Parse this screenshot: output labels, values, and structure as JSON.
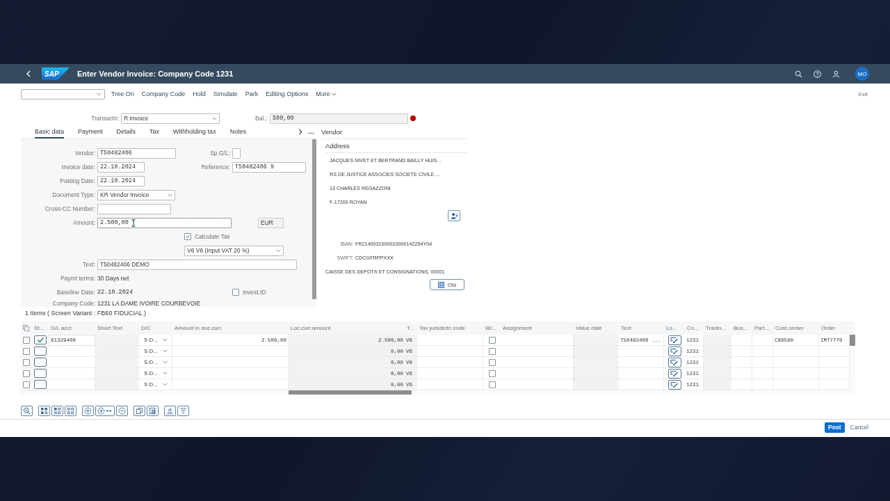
{
  "shell": {
    "logo": "SAP",
    "title": "Enter Vendor Invoice: Company Code 1231",
    "avatar": "MO"
  },
  "toolbar": {
    "buttons": [
      "Tree On",
      "Company Code",
      "Hold",
      "Simulate",
      "Park",
      "Editing Options"
    ],
    "more": "More",
    "exit": "Exit"
  },
  "header": {
    "transaction": {
      "label": "Transactn:",
      "value": "R Invoice"
    },
    "balance": {
      "label": "Bal.:",
      "value": "500,00",
      "balanced": false
    }
  },
  "tabs": [
    {
      "label": "Basic data",
      "selected": true
    },
    {
      "label": "Payment",
      "selected": false
    },
    {
      "label": "Details",
      "selected": false
    },
    {
      "label": "Tax",
      "selected": false
    },
    {
      "label": "Withholding tax",
      "selected": false
    },
    {
      "label": "Notes",
      "selected": false
    }
  ],
  "basic_data": {
    "vendor": {
      "label": "Vendor:",
      "value": "T50482406"
    },
    "special_gl": {
      "label": "Sp.G/L:"
    },
    "invoice_date": {
      "label": "Invoice date:",
      "value": "22.10.2024"
    },
    "reference": {
      "label": "Reference:",
      "value": "T50482406 9"
    },
    "posting_date": {
      "label": "Posting Date:",
      "value": "22.10.2024"
    },
    "document_type": {
      "label": "Document Type:",
      "value": "KR Vendor Invoice"
    },
    "cross_cc_number": {
      "label": "Cross-CC Number:"
    },
    "amount": {
      "label": "Amount:",
      "value": "2.500,00",
      "focused": true
    },
    "currency": "EUR",
    "calculate_tax": {
      "label": "Calculate Tax",
      "checked": true
    },
    "tax_code": "V6 V6 (Input VAT 20 %)",
    "text": {
      "label": "Text:",
      "value": "T50482406 DEMO"
    },
    "payment_terms": {
      "label": "Paymt terms:",
      "value": "30 Days net"
    },
    "baseline_date": {
      "label": "Baseline Date:",
      "value": "22.10.2024"
    },
    "invest_id": {
      "label": "Invest.ID",
      "checked": false
    },
    "company_code": {
      "label": "Company Code:",
      "value": "1231 LA DAME IVOIRE COURBEVOIE"
    }
  },
  "vendor_panel": {
    "title": "Vendor",
    "address_title": "Address",
    "address_lines": [
      "JACQUES NIVET ET BERTRAND BAILLY HUIS...",
      "RS DE JUSTICE ASSOCIES SOCIETE CIVILE ...",
      "13 CHARLES REGAZZONI",
      "F-17200 ROYAN"
    ],
    "iban": {
      "label": "IBAN:",
      "value": "FR2140031000010000142254Y04"
    },
    "swift": {
      "label": "SWIFT:",
      "value": "CDCGFRPPXXX"
    },
    "bank": "CAISSE DES DEPOTS ET CONSIGNATIONS, 00001",
    "open_items_button": "OIs"
  },
  "items": {
    "title": "1 Items ( Screen Variant : FB60 FIDUCIAL )",
    "columns": [
      "St...",
      "G/L acct",
      "Short Text",
      "D/C",
      "Amount in doc.curr.",
      "Loc.curr.amount",
      "T...",
      "Tax jurisdictn code",
      "W/...",
      "Assignment",
      "Value date",
      "Text",
      "Lo...",
      "Co...",
      "Tradin...",
      "Bus...",
      "Part...",
      "Cost center",
      "Order"
    ],
    "rows": [
      {
        "selected": false,
        "checked": true,
        "gl_acct": "61329400",
        "dc": "S D...",
        "amount_doc": "2.500,00",
        "amount_loc": "2.500,00",
        "tax_code": "V6",
        "withholding": false,
        "text": "T50482406 ...",
        "company_code": "1231",
        "cost_center": "C89580",
        "order": "IM77770"
      },
      {
        "selected": false,
        "checked": false,
        "dc": "S D...",
        "amount_loc": "0,00",
        "tax_code": "V6",
        "withholding": false,
        "company_code": "1231"
      },
      {
        "selected": false,
        "checked": false,
        "dc": "S D...",
        "amount_loc": "0,00",
        "tax_code": "V6",
        "withholding": false,
        "company_code": "1231"
      },
      {
        "selected": false,
        "checked": false,
        "dc": "S D...",
        "amount_loc": "0,00",
        "tax_code": "V6",
        "withholding": false,
        "company_code": "1231"
      },
      {
        "selected": false,
        "checked": false,
        "dc": "S D...",
        "amount_loc": "0,00",
        "tax_code": "V6",
        "withholding": false,
        "company_code": "1231"
      }
    ]
  },
  "footer": {
    "post": "Post",
    "cancel": "Cancel"
  }
}
